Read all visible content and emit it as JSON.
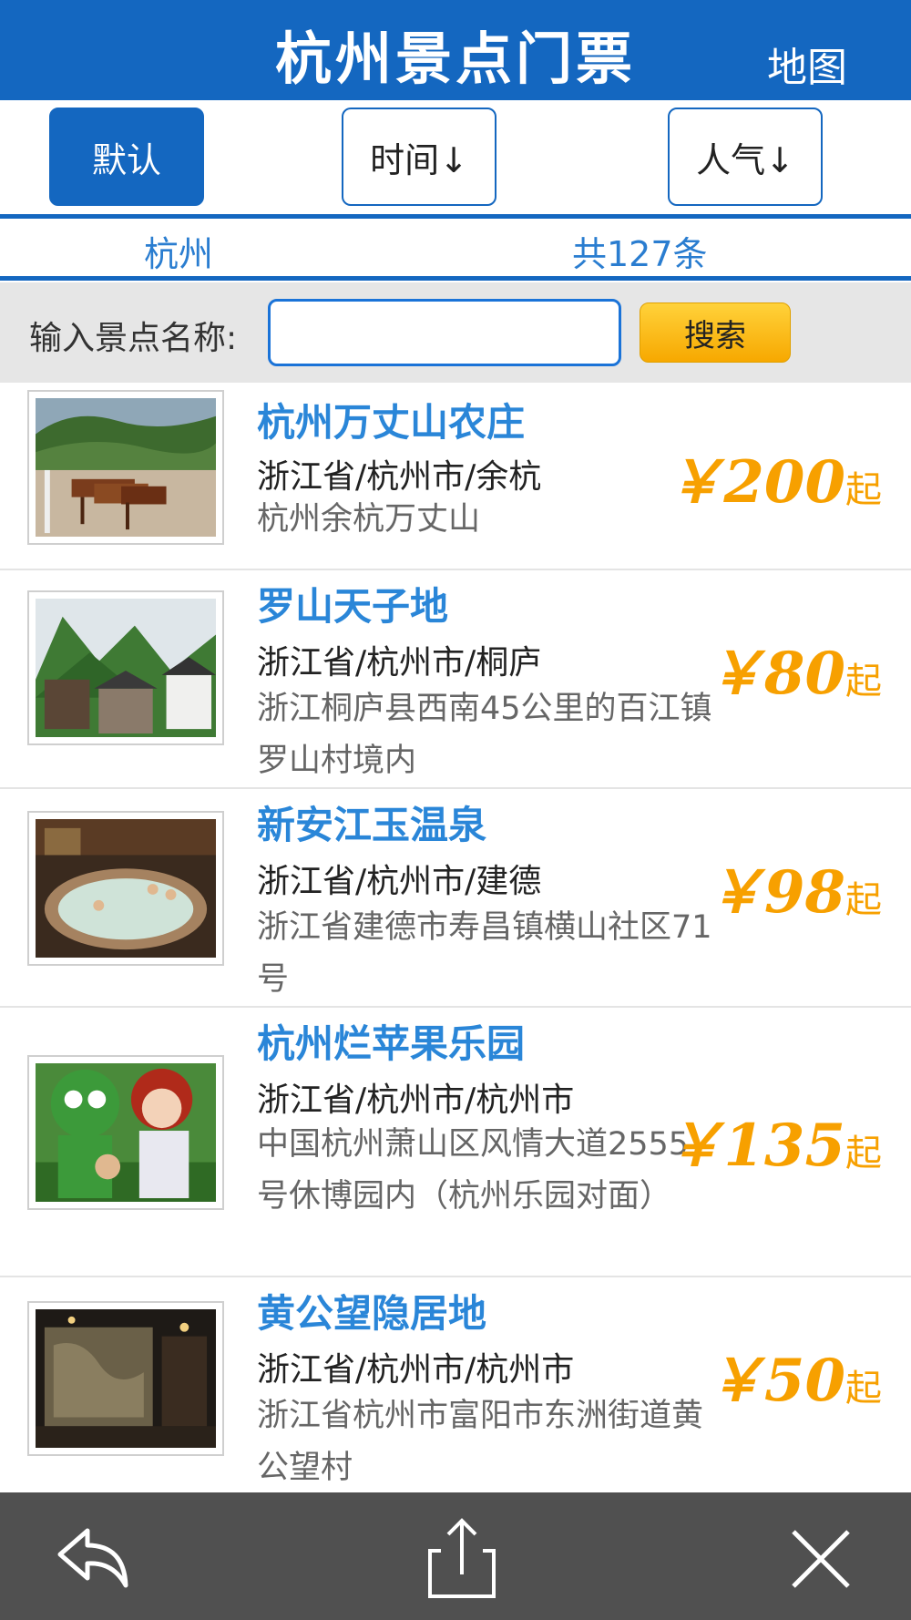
{
  "header": {
    "title": "杭州景点门票",
    "map_label": "地图"
  },
  "sort": {
    "default_label": "默认",
    "time_label": "时间↓",
    "popularity_label": "人气↓"
  },
  "info": {
    "city": "杭州",
    "count": "共127条"
  },
  "search": {
    "label": "输入景点名称:",
    "value": "",
    "placeholder": "",
    "button": "搜索"
  },
  "items": [
    {
      "name": "杭州万丈山农庄",
      "region": "浙江省/杭州市/余杭",
      "address": "杭州余杭万丈山",
      "price": "￥200",
      "suffix": "起",
      "image": "horses-farm"
    },
    {
      "name": "罗山天子地",
      "region": "浙江省/杭州市/桐庐",
      "address": "浙江桐庐县西南45公里的百江镇罗山村境内",
      "price": "￥80",
      "suffix": "起",
      "image": "mountain-village"
    },
    {
      "name": "新安江玉温泉",
      "region": "浙江省/杭州市/建德",
      "address": "浙江省建德市寿昌镇横山社区71号",
      "price": "￥98",
      "suffix": "起",
      "image": "hot-spring"
    },
    {
      "name": "杭州烂苹果乐园",
      "region": "浙江省/杭州市/杭州市",
      "address": "中国杭州萧山区风情大道2555号休博园内（杭州乐园对面）",
      "price": "￥135",
      "suffix": "起",
      "image": "mascots"
    },
    {
      "name": "黄公望隐居地",
      "region": "浙江省/杭州市/杭州市",
      "address": "浙江省杭州市富阳市东洲街道黄公望村",
      "price": "￥50",
      "suffix": "起",
      "image": "relief-wall"
    }
  ],
  "toolbar": {
    "back_icon": "reply-arrow-icon",
    "share_icon": "share-icon",
    "close_icon": "close-icon"
  },
  "colors": {
    "brand_blue": "#1467c0",
    "link_blue": "#2a86d8",
    "price_orange": "#f7a000",
    "toolbar_gray": "#505050"
  }
}
